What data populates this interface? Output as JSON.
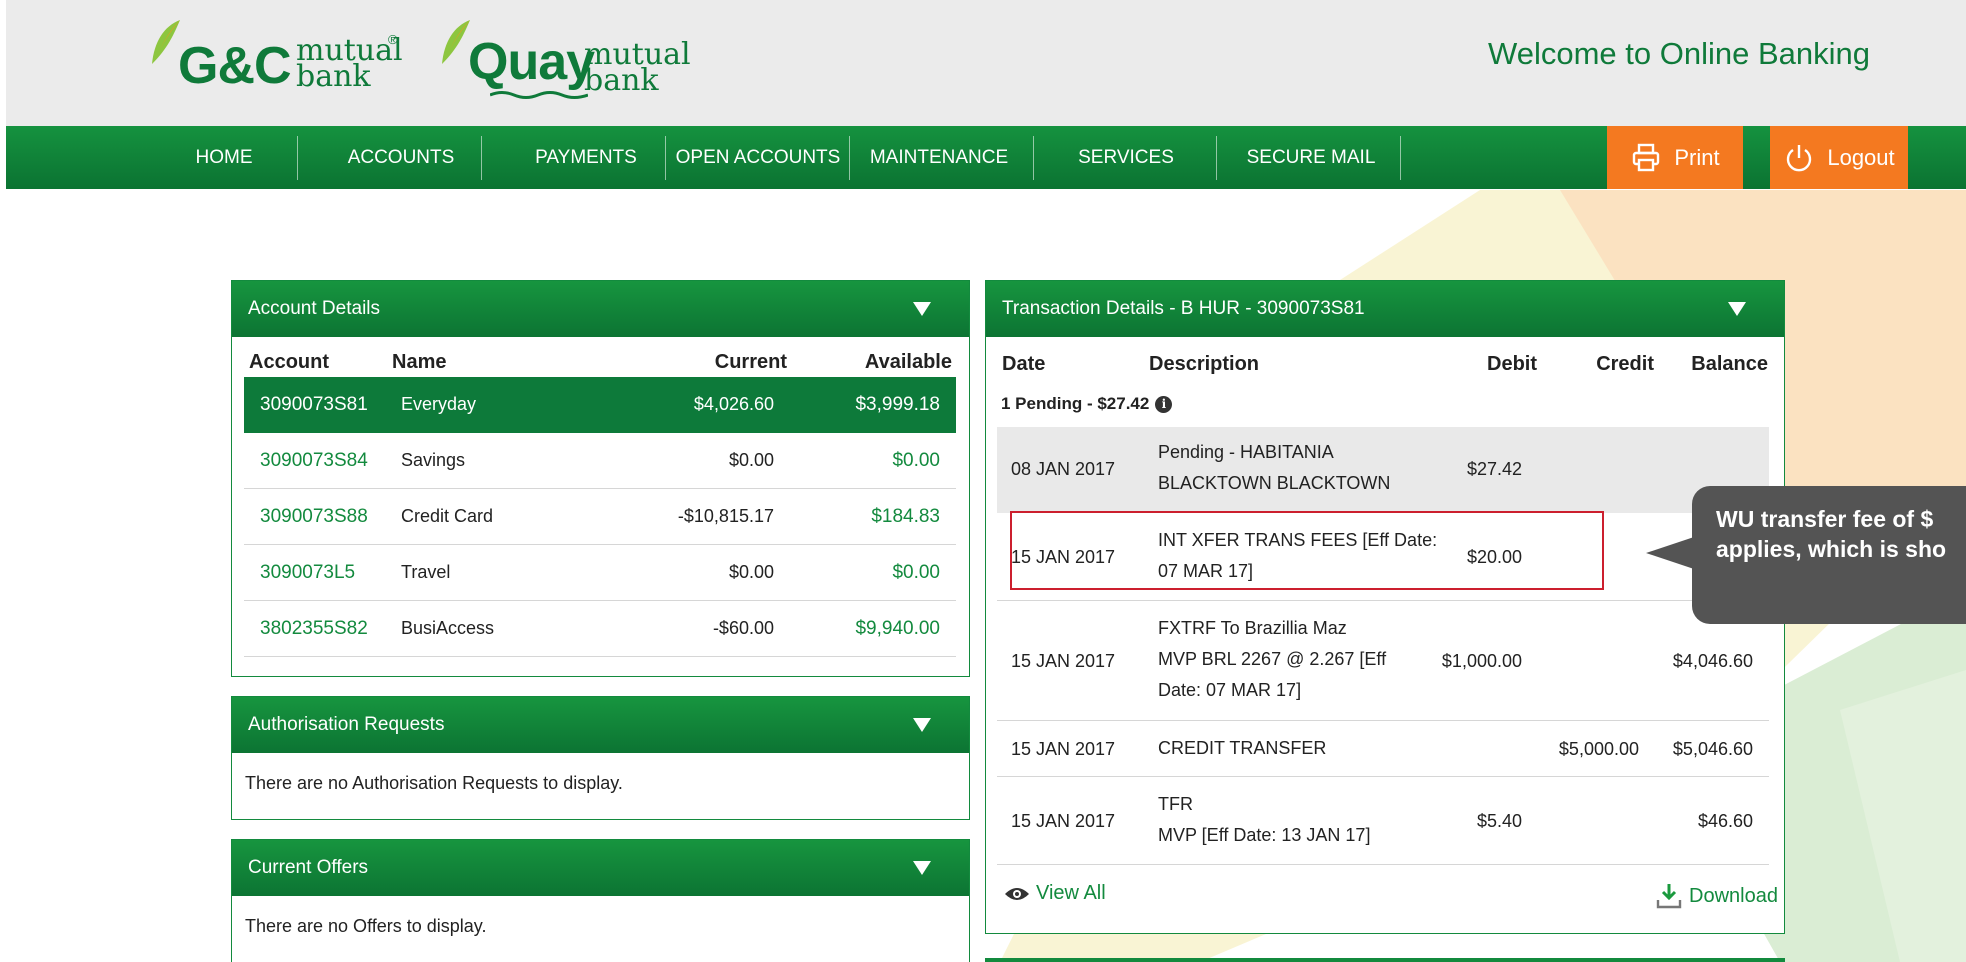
{
  "brand": {
    "gc_name": "G&C",
    "gc_sub": "mutual\nbank",
    "gc_reg": "®",
    "quay_name": "Quay",
    "quay_sub": "mutual\nbank",
    "welcome": "Welcome to Online Banking"
  },
  "nav": {
    "items": [
      "HOME",
      "ACCOUNTS",
      "PAYMENTS",
      "OPEN ACCOUNTS",
      "MAINTENANCE",
      "SERVICES",
      "SECURE MAIL"
    ],
    "print_label": "Print",
    "logout_label": "Logout"
  },
  "account_details": {
    "title": "Account Details",
    "columns": [
      "Account",
      "Name",
      "Current",
      "Available"
    ],
    "rows": [
      {
        "account": "3090073S81",
        "name": "Everyday",
        "current": "$4,026.60",
        "available": "$3,999.18"
      },
      {
        "account": "3090073S84",
        "name": "Savings",
        "current": "$0.00",
        "available": "$0.00"
      },
      {
        "account": "3090073S88",
        "name": "Credit Card",
        "current": "-$10,815.17",
        "available": "$184.83"
      },
      {
        "account": "3090073L5",
        "name": "Travel",
        "current": "$0.00",
        "available": "$0.00"
      },
      {
        "account": "3802355S82",
        "name": "BusiAccess",
        "current": "-$60.00",
        "available": "$9,940.00"
      }
    ]
  },
  "authorisation": {
    "title": "Authorisation Requests",
    "message": "There are no Authorisation Requests to display."
  },
  "offers": {
    "title": "Current Offers",
    "message": "There are no Offers to display."
  },
  "transactions": {
    "title": "Transaction Details - B HUR - 3090073S81",
    "columns": [
      "Date",
      "Description",
      "Debit",
      "Credit",
      "Balance"
    ],
    "pending_summary": "1 Pending - $27.42",
    "rows": [
      {
        "date": "08 JAN 2017",
        "desc": [
          "Pending - HABITANIA",
          "BLACKTOWN BLACKTOWN"
        ],
        "debit": "$27.42",
        "credit": "",
        "balance": ""
      },
      {
        "date": "15 JAN 2017",
        "desc": [
          "INT XFER TRANS FEES [Eff Date:",
          "07 MAR 17]"
        ],
        "debit": "$20.00",
        "credit": "",
        "balance": ""
      },
      {
        "date": "15 JAN 2017",
        "desc": [
          "FXTRF To Brazillia Maz",
          "MVP BRL 2267 @ 2.267 [Eff",
          "Date: 07 MAR 17]"
        ],
        "debit": "$1,000.00",
        "credit": "",
        "balance": "$4,046.60"
      },
      {
        "date": "15 JAN 2017",
        "desc": [
          "CREDIT TRANSFER"
        ],
        "debit": "",
        "credit": "$5,000.00",
        "balance": "$5,046.60"
      },
      {
        "date": "15 JAN 2017",
        "desc": [
          "TFR",
          "MVP [Eff Date: 13 JAN 17]"
        ],
        "debit": "$5.40",
        "credit": "",
        "balance": "$46.60"
      }
    ],
    "view_all": "View All",
    "download": "Download"
  },
  "callout": {
    "line1": "WU transfer fee of $",
    "line2": "applies, which is sho"
  },
  "colors": {
    "brand_green": "#0f7a3a",
    "nav_orange": "#f47920",
    "highlight_red": "#cc1f2e",
    "callout_gray": "#545454"
  }
}
